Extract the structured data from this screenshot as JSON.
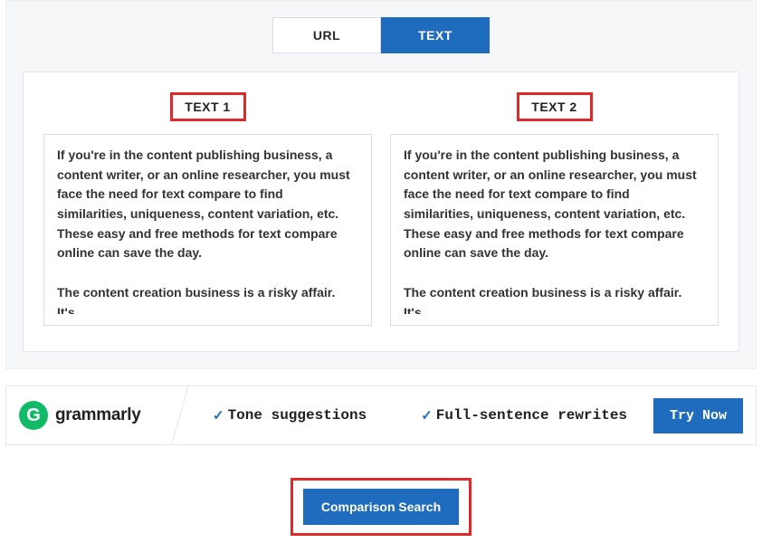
{
  "tabs": {
    "url_label": "URL",
    "text_label": "TEXT"
  },
  "columns": {
    "left_header": "TEXT 1",
    "right_header": "TEXT 2",
    "left_value": "If you're in the content publishing business, a content writer, or an online researcher, you must face the need for text compare to find similarities, uniqueness, content variation, etc. These easy and free methods for text compare online can save the day.\n\nThe content creation business is a risky affair. It's",
    "right_value": "If you're in the content publishing business, a content writer, or an online researcher, you must face the need for text compare to find similarities, uniqueness, content variation, etc. These easy and free methods for text compare online can save the day.\n\nThe content creation business is a risky affair. It's"
  },
  "ad": {
    "logo_letter": "G",
    "brand": "grammarly",
    "feature1": "Tone suggestions",
    "feature2": "Full-sentence rewrites",
    "cta": "Try Now"
  },
  "action": {
    "button_label": "Comparison Search"
  }
}
